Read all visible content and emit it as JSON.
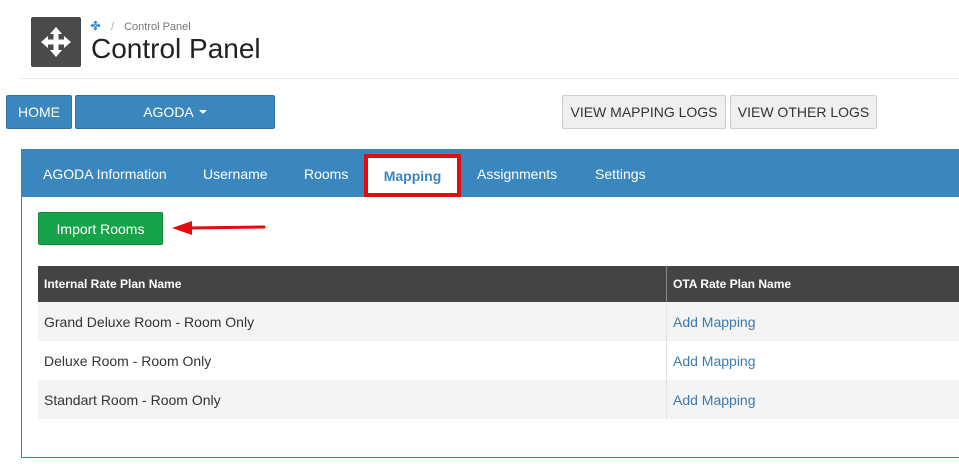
{
  "header": {
    "breadcrumb": "Control Panel",
    "title": "Control Panel",
    "app_icon": "move-arrows-icon",
    "breadcrumb_icon": "move-arrows-icon"
  },
  "toolbar": {
    "home_label": "HOME",
    "agoda_label": "AGODA",
    "view_mapping_logs_label": "VIEW MAPPING LOGS",
    "view_other_logs_label": "VIEW OTHER LOGS"
  },
  "tabs": [
    {
      "label": "AGODA Information"
    },
    {
      "label": "Username"
    },
    {
      "label": "Rooms"
    },
    {
      "label": "Mapping",
      "active": true
    },
    {
      "label": "Assignments"
    },
    {
      "label": "Settings"
    }
  ],
  "import_button_label": "Import Rooms",
  "table": {
    "headers": [
      "Internal Rate Plan Name",
      "OTA Rate Plan Name"
    ],
    "rows": [
      {
        "name": "Grand Deluxe Room - Room Only",
        "action": "Add Mapping"
      },
      {
        "name": "Deluxe Room - Room Only",
        "action": "Add Mapping"
      },
      {
        "name": "Standart Room - Room Only",
        "action": "Add Mapping"
      }
    ]
  },
  "colors": {
    "primary": "#3a87c0",
    "success": "#16a34a",
    "highlight": "#e30b0b",
    "table_header": "#444444"
  }
}
